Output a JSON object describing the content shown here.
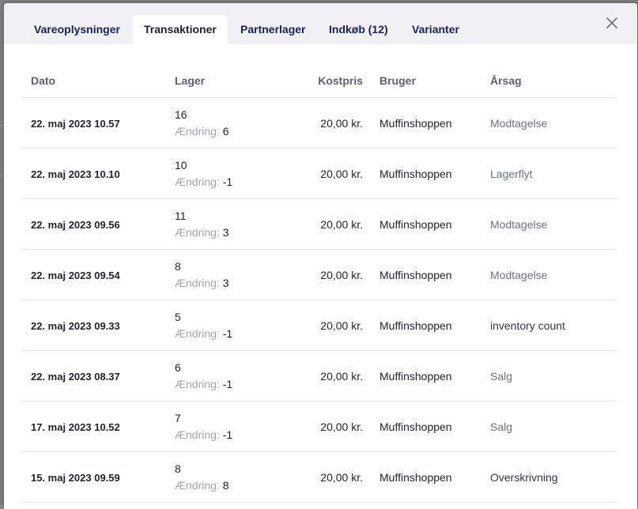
{
  "tabs": [
    {
      "label": "Vareoplysninger",
      "active": false
    },
    {
      "label": "Transaktioner",
      "active": true
    },
    {
      "label": "Partnerlager",
      "active": false
    },
    {
      "label": "Indkøb (12)",
      "active": false
    },
    {
      "label": "Varianter",
      "active": false
    }
  ],
  "close_icon": "close-icon",
  "table": {
    "headers": {
      "date": "Dato",
      "stock": "Lager",
      "cost": "Kostpris",
      "user": "Bruger",
      "reason": "Årsag"
    },
    "change_label": "Ændring:",
    "rows": [
      {
        "date": "22. maj 2023 10.57",
        "stock": "16",
        "change": "6",
        "cost": "20,00 kr.",
        "user": "Muffinshoppen",
        "reason": "Modtagelse",
        "reason_color": "#6c757d"
      },
      {
        "date": "22. maj 2023 10.10",
        "stock": "10",
        "change": "-1",
        "cost": "20,00 kr.",
        "user": "Muffinshoppen",
        "reason": "Lagerflyt",
        "reason_color": "#6c757d"
      },
      {
        "date": "22. maj 2023 09.56",
        "stock": "11",
        "change": "3",
        "cost": "20,00 kr.",
        "user": "Muffinshoppen",
        "reason": "Modtagelse",
        "reason_color": "#6c757d"
      },
      {
        "date": "22. maj 2023 09.54",
        "stock": "8",
        "change": "3",
        "cost": "20,00 kr.",
        "user": "Muffinshoppen",
        "reason": "Modtagelse",
        "reason_color": "#6c757d"
      },
      {
        "date": "22. maj 2023 09.33",
        "stock": "5",
        "change": "-1",
        "cost": "20,00 kr.",
        "user": "Muffinshoppen",
        "reason": "inventory count",
        "reason_color": "#343a40"
      },
      {
        "date": "22. maj 2023 08.37",
        "stock": "6",
        "change": "-1",
        "cost": "20,00 kr.",
        "user": "Muffinshoppen",
        "reason": "Salg",
        "reason_color": "#6c757d"
      },
      {
        "date": "17. maj 2023 10.52",
        "stock": "7",
        "change": "-1",
        "cost": "20,00 kr.",
        "user": "Muffinshoppen",
        "reason": "Salg",
        "reason_color": "#6c757d"
      },
      {
        "date": "15. maj 2023 09.59",
        "stock": "8",
        "change": "8",
        "cost": "20,00 kr.",
        "user": "Muffinshoppen",
        "reason": "Overskrivning",
        "reason_color": "#343a40"
      }
    ]
  }
}
